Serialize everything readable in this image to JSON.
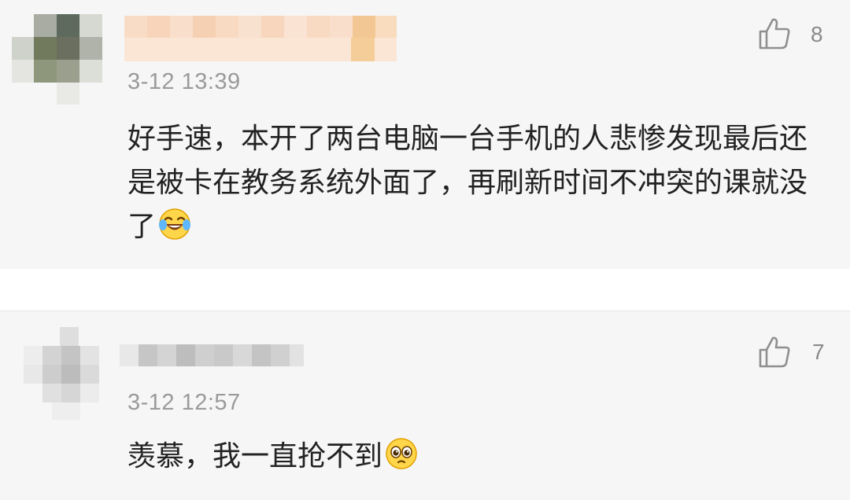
{
  "comments": [
    {
      "time": "3-12 13:39",
      "text": "好手速，本开了两台电脑一台手机的人悲惨发现最后还是被卡在教务系统外面了，再刷新时间不冲突的课就没了",
      "emoji_icon": "laughing-crying-emoji-icon",
      "likes": "8"
    },
    {
      "time": "3-12 12:57",
      "text": "羡慕，我一直抢不到",
      "emoji_icon": "pleading-eyes-emoji-icon",
      "likes": "7"
    }
  ],
  "icons": {
    "like": "thumbs-up-icon"
  },
  "colors": {
    "card_bg": "#f6f6f6",
    "text": "#222222",
    "meta": "#9a9a9a",
    "username_blur_1": "#f5c9a4",
    "username_blur_2": "#c8c8c8"
  }
}
